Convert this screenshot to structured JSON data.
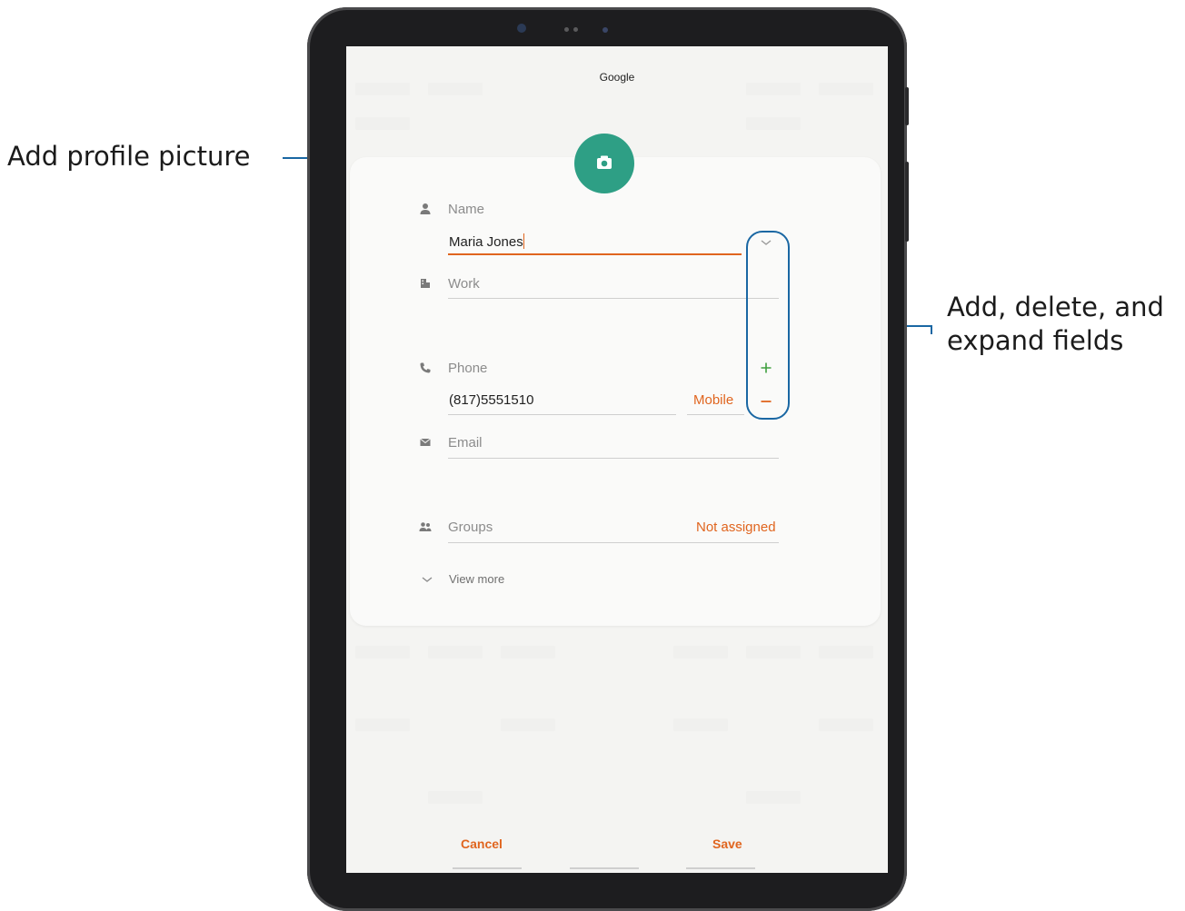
{
  "callouts": {
    "profile_picture": "Add profile picture",
    "fields_line1": "Add, delete, and",
    "fields_line2": "expand fields"
  },
  "screen": {
    "account": "Google",
    "name": {
      "label": "Name",
      "value": "Maria Jones"
    },
    "work": {
      "label": "Work"
    },
    "phone": {
      "label": "Phone",
      "value": "(817)5551510",
      "type": "Mobile"
    },
    "email": {
      "label": "Email"
    },
    "groups": {
      "label": "Groups",
      "value": "Not assigned"
    },
    "view_more": "View more",
    "cancel": "Cancel",
    "save": "Save"
  },
  "icons": {
    "avatar": "camera-icon",
    "name": "person-icon",
    "work": "building-icon",
    "phone": "phone-icon",
    "email": "mail-icon",
    "groups": "people-icon",
    "view_more": "chevron-down-icon",
    "expand": "chevron-down-icon",
    "add": "plus-icon",
    "remove": "minus-icon"
  },
  "colors": {
    "accent": "#e0651f",
    "avatar": "#2e9f85",
    "add": "#3f9f3f",
    "callout_line": "#1a67a3"
  }
}
